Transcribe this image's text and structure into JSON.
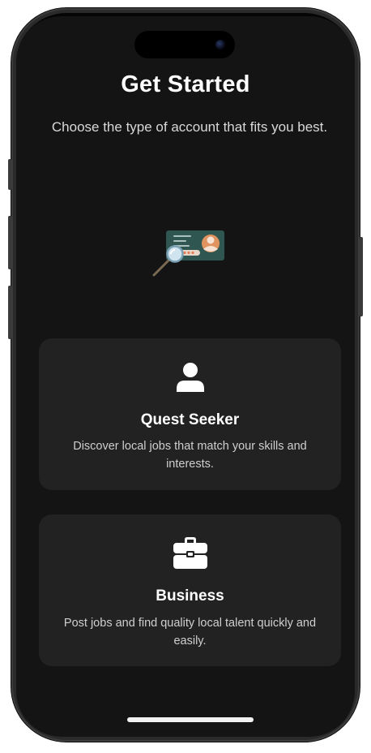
{
  "header": {
    "title": "Get Started",
    "subtitle": "Choose the type of account that fits you best."
  },
  "illustration": {
    "icon": "id-card-magnifier-icon"
  },
  "options": [
    {
      "icon": "person-icon",
      "title": "Quest Seeker",
      "description": "Discover local jobs that match your skills and interests."
    },
    {
      "icon": "briefcase-icon",
      "title": "Business",
      "description": "Post jobs and find quality local talent quickly and easily."
    }
  ],
  "colors": {
    "background": "#141414",
    "card": "#222222",
    "text_primary": "#ffffff",
    "text_secondary": "#cfcfcf",
    "illustration_card": "#2f5650",
    "illustration_avatar": "#e0935f"
  }
}
